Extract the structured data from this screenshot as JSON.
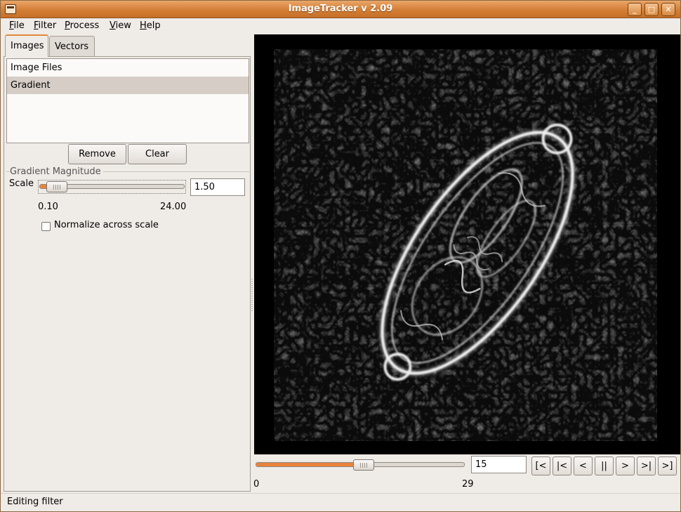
{
  "window": {
    "title": "ImageTracker v 2.09"
  },
  "menu": [
    "File",
    "Filter",
    "Process",
    "View",
    "Help"
  ],
  "tabs": [
    {
      "label": "Images",
      "active": true
    },
    {
      "label": "Vectors",
      "active": false
    }
  ],
  "image_list": [
    {
      "label": "Image Files",
      "selected": false
    },
    {
      "label": "Gradient",
      "selected": true
    }
  ],
  "buttons": {
    "remove": "Remove",
    "clear": "Clear"
  },
  "filter": {
    "group_title": "Gradient Magnitude",
    "scale_label": "Scale",
    "scale_value": "1.50",
    "scale_min": "0.10",
    "scale_max": "24.00",
    "scale_fraction": 0.058,
    "normalize_label": "Normalize across scale",
    "normalize_checked": false
  },
  "frame": {
    "value": "15",
    "min": "0",
    "max": "29",
    "fraction": 0.517
  },
  "nav_buttons": [
    {
      "label": "[<",
      "name": "first-frame-button"
    },
    {
      "label": "|<",
      "name": "step-back-button"
    },
    {
      "label": "<",
      "name": "play-backward-button"
    },
    {
      "label": "||",
      "name": "pause-button"
    },
    {
      "label": ">",
      "name": "play-forward-button"
    },
    {
      "label": ">|",
      "name": "step-forward-button"
    },
    {
      "label": ">]",
      "name": "last-frame-button"
    }
  ],
  "status": "Editing filter",
  "colors": {
    "accent": "#e9823a",
    "titlebar": "#d47e35",
    "window_bg": "#efebe7",
    "viewer_bg": "#000000"
  }
}
